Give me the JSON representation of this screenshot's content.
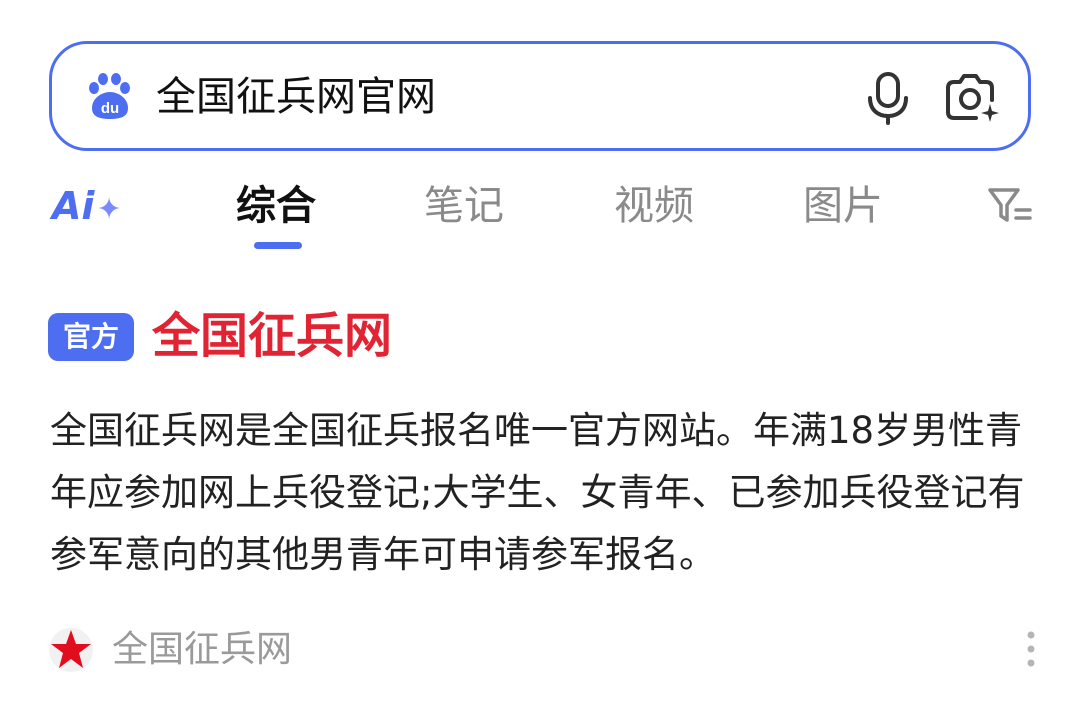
{
  "search": {
    "query": "全国征兵网官网",
    "logo_icon": "baidu-paw-icon",
    "mic_icon": "microphone-icon",
    "camera_icon": "camera-search-icon",
    "border_color": "#4e6ef2"
  },
  "tabs": {
    "ai_label": "Ai",
    "ai_spark": "✦",
    "items": [
      {
        "label": "综合",
        "active": true
      },
      {
        "label": "笔记",
        "active": false
      },
      {
        "label": "视频",
        "active": false
      },
      {
        "label": "图片",
        "active": false
      }
    ],
    "filter_icon": "filter-icon"
  },
  "result": {
    "badge": "官方",
    "title": "全国征兵网",
    "abstract": "全国征兵网是全国征兵报名唯一官方网站。年满18岁男性青年应参加网上兵役登记;大学生、女青年、已参加兵役登记有参军意向的其他男青年可申请参军报名。",
    "source_name": "全国征兵网",
    "source_icon": "red-star-icon",
    "more_icon": "more-vertical-icon",
    "title_color": "#e02433",
    "badge_color": "#4e6ef2"
  }
}
